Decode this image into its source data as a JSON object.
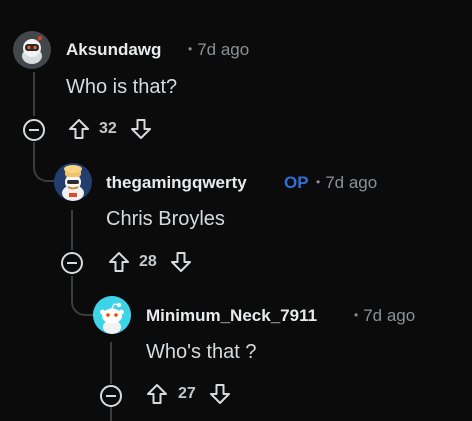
{
  "comments": [
    {
      "username": "Aksundawg",
      "op": "",
      "time": "7d ago",
      "text": "Who is that?",
      "score": "32",
      "avatar_icon": "snoo-astronaut-avatar"
    },
    {
      "username": "thegamingqwerty",
      "op": "OP",
      "time": "7d ago",
      "text": "Chris Broyles",
      "score": "28",
      "avatar_icon": "snoo-chef-avatar"
    },
    {
      "username": "Minimum_Neck_7911",
      "op": "",
      "time": "7d ago",
      "text": "Who's that ?",
      "score": "27",
      "avatar_icon": "snoo-default-avatar"
    }
  ],
  "colors": {
    "background": "#0b0b0c",
    "op_badge": "#2f6fd6",
    "thread_line": "#3a3d40",
    "avatar_cyan": "#3ed3e6"
  }
}
